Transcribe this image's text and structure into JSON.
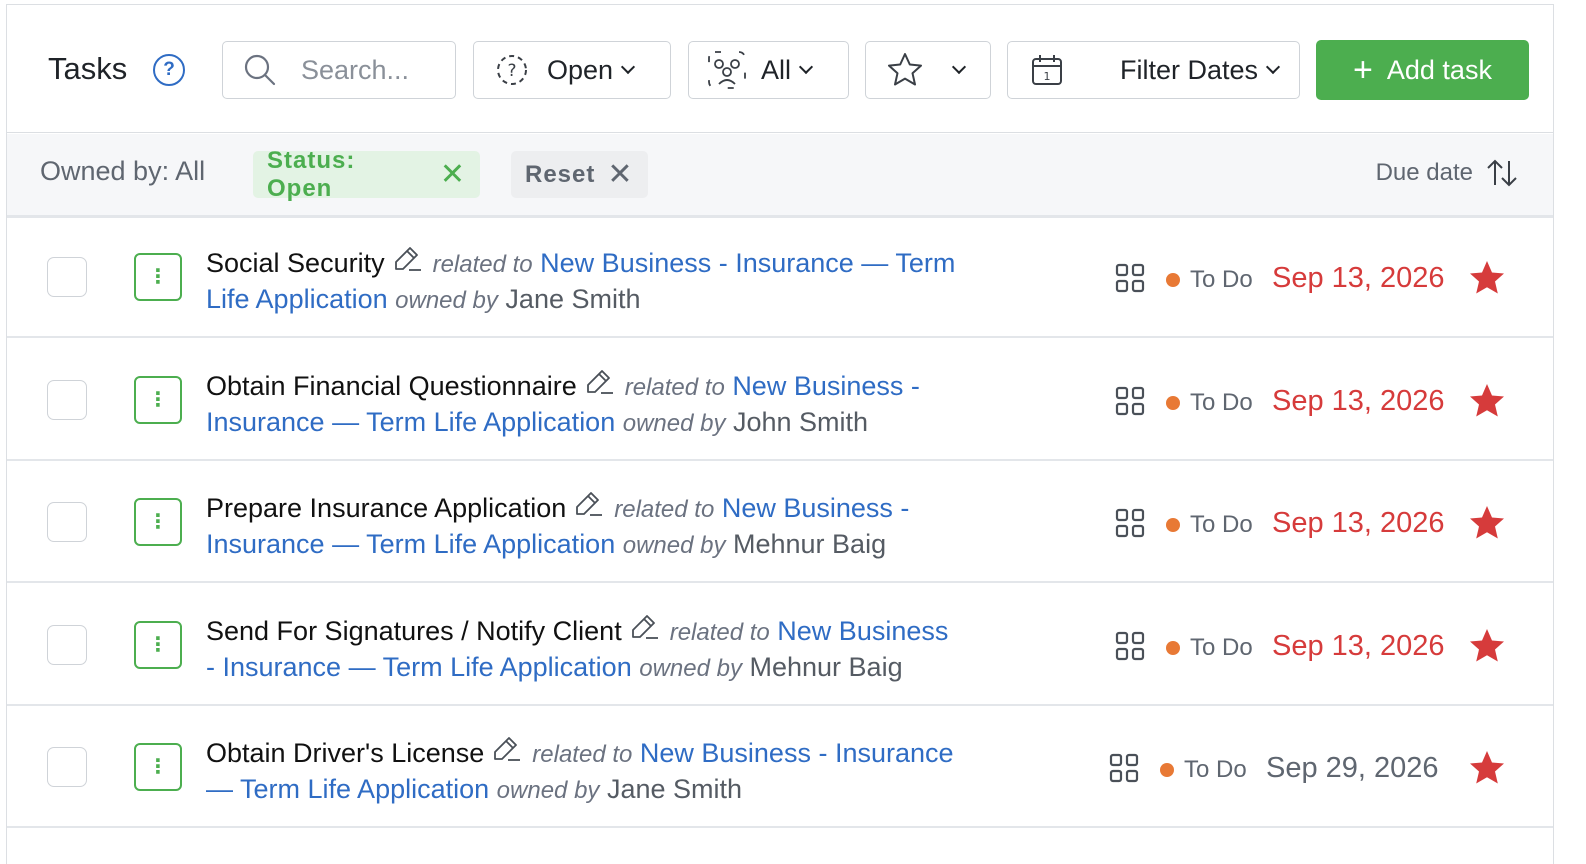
{
  "header": {
    "title": "Tasks",
    "help_icon": "question-circle-icon",
    "search_placeholder": "Search...",
    "status_filter": "Open",
    "owner_filter": "All",
    "date_filter": "Filter Dates",
    "add_task_label": "Add task"
  },
  "filters": {
    "owned_by": "Owned by: All",
    "status_chip": "Status: Open",
    "reset_chip": "Reset",
    "sort_label": "Due date"
  },
  "colors": {
    "accent_green": "#4cae4f",
    "link_blue": "#2f6cc4",
    "overdue_red": "#d63b3b",
    "status_orange": "#e87935"
  },
  "tasks": [
    {
      "name": "Social Security",
      "related_word": "related to",
      "related_line1": "New Business - Insurance — Term",
      "related_line2": "Life Application",
      "owned_word": "owned by",
      "owner": "Jane Smith",
      "status": "To Do",
      "due": "Sep 13, 2026",
      "due_color": "#d63b3b"
    },
    {
      "name": "Obtain Financial Questionnaire",
      "related_word": "related to",
      "related_line1": "New Business -",
      "related_line2": "Insurance — Term Life Application",
      "owned_word": "owned by",
      "owner": "John Smith",
      "status": "To Do",
      "due": "Sep 13, 2026",
      "due_color": "#d63b3b"
    },
    {
      "name": "Prepare Insurance Application",
      "related_word": "related to",
      "related_line1": "New Business -",
      "related_line2": "Insurance — Term Life Application",
      "owned_word": "owned by",
      "owner": "Mehnur Baig",
      "status": "To Do",
      "due": "Sep 13, 2026",
      "due_color": "#d63b3b"
    },
    {
      "name": "Send For Signatures / Notify Client",
      "related_word": "related to",
      "related_line1": "New Business",
      "related_line2": "- Insurance — Term Life Application",
      "owned_word": "owned by",
      "owner": "Mehnur Baig",
      "status": "To Do",
      "due": "Sep 13, 2026",
      "due_color": "#d63b3b"
    },
    {
      "name": "Obtain Driver's License",
      "related_word": "related to",
      "related_line1": "New Business - Insurance",
      "related_line2": "— Term Life Application",
      "owned_word": "owned by",
      "owner": "Jane Smith",
      "status": "To Do",
      "due": "Sep 29, 2026",
      "due_color": "#5f6670"
    }
  ]
}
